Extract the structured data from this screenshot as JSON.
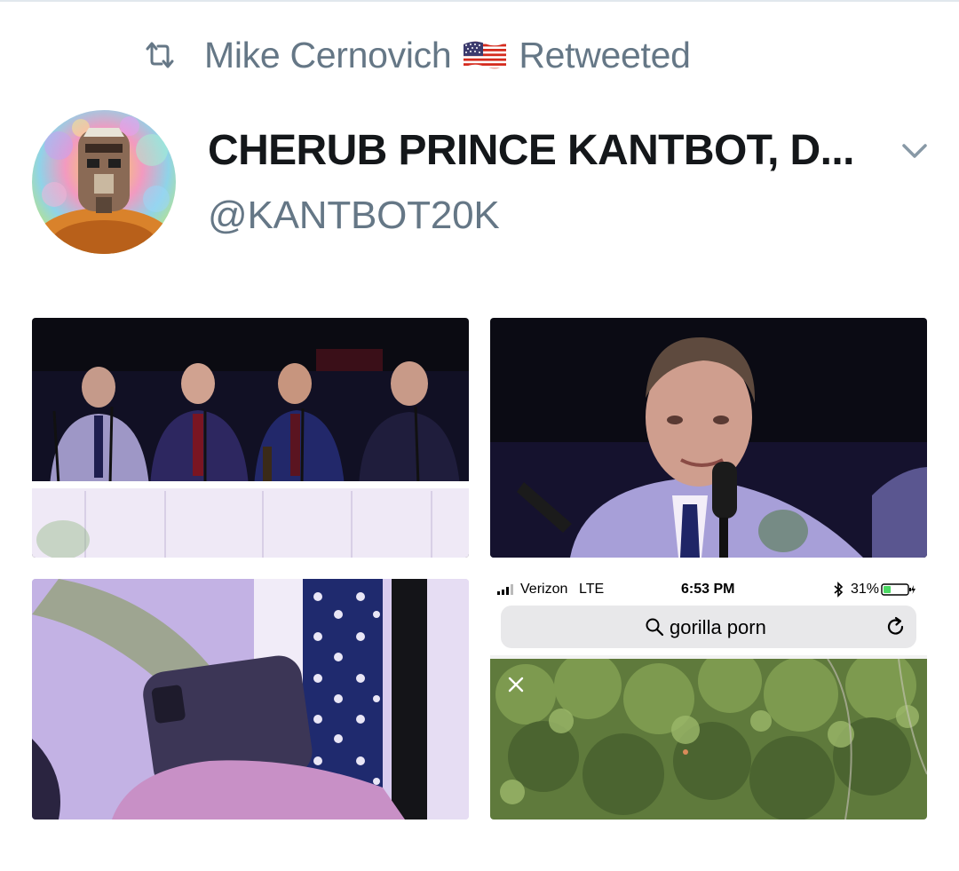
{
  "retweet": {
    "icon": "retweet-icon",
    "user": "Mike Cernovich",
    "flag": "us-flag-emoji",
    "label": "Retweeted"
  },
  "tweet": {
    "display_name": "CHERUB PRINCE KANTBOT, D...",
    "handle": "@KANTBOT20K",
    "menu_icon": "chevron-down-icon"
  },
  "media": {
    "photo_4": {
      "status_bar": {
        "carrier": "Verizon",
        "network": "LTE",
        "time": "6:53 PM",
        "battery": "31%",
        "battery_level": 0.31
      },
      "search_query": "gorilla porn",
      "icons": [
        "search-icon",
        "reload-icon",
        "close-icon"
      ]
    }
  },
  "colors": {
    "secondary_text": "#657786",
    "primary_text": "#14171a",
    "battery_green": "#4cd964"
  }
}
